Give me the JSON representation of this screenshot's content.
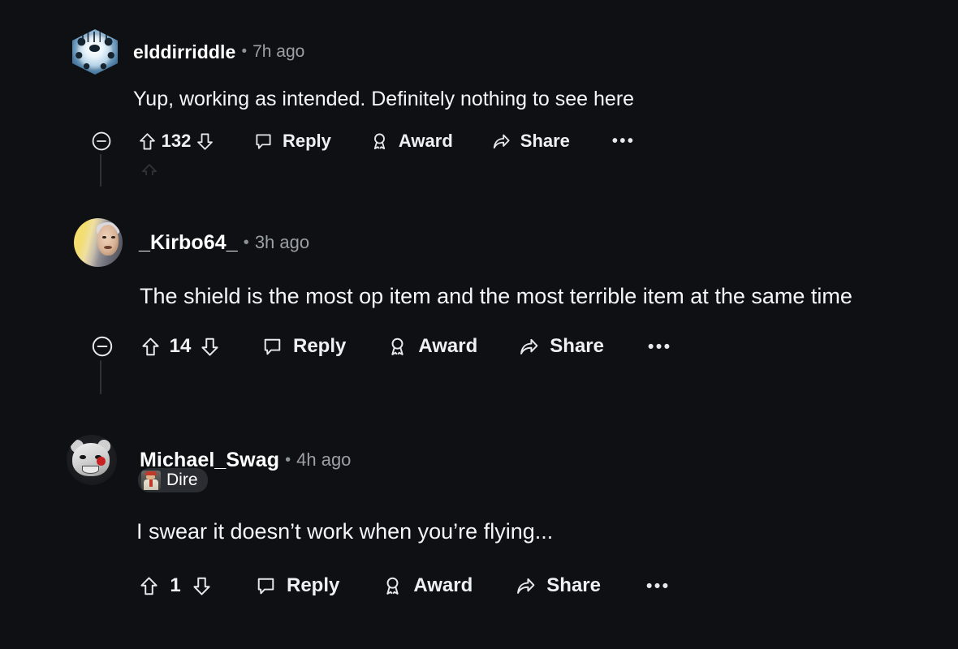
{
  "theme": {
    "background": "#0e1013",
    "text_primary": "#f4f6f7",
    "text_muted": "#9aa0a6",
    "thread_line": "#2f3336",
    "flair_background": "#2a2d31"
  },
  "separator": "•",
  "overflow_label": "•••",
  "action_labels": {
    "collapse": "Collapse",
    "upvote": "Upvote",
    "downvote": "Downvote",
    "reply": "Reply",
    "award": "Award",
    "share": "Share",
    "more": "More options"
  },
  "comments": [
    {
      "username": "elddirriddle",
      "timestamp": "7h ago",
      "body": "Yup, working as intended. Definitely nothing to see here",
      "score": "132",
      "avatar_kind": "hex-nft-icy",
      "has_collapse": true,
      "flair": null,
      "actions": [
        {
          "name": "reply",
          "label": "Reply",
          "icon": "comment-bubble-icon"
        },
        {
          "name": "award",
          "label": "Award",
          "icon": "award-ribbon-icon"
        },
        {
          "name": "share",
          "label": "Share",
          "icon": "share-arrow-icon"
        }
      ]
    },
    {
      "username": "_Kirbo64_",
      "timestamp": "3h ago",
      "body": "The shield is the most op item and the most terrible item at the same time",
      "score": "14",
      "avatar_kind": "photo-yellow-face",
      "has_collapse": true,
      "flair": null,
      "actions": [
        {
          "name": "reply",
          "label": "Reply",
          "icon": "comment-bubble-icon"
        },
        {
          "name": "award",
          "label": "Award",
          "icon": "award-ribbon-icon"
        },
        {
          "name": "share",
          "label": "Share",
          "icon": "share-arrow-icon"
        }
      ]
    },
    {
      "username": "Michael_Swag",
      "timestamp": "4h ago",
      "body": "I swear it doesn’t work when you’re flying...",
      "score": "1",
      "avatar_kind": "cartoon-greyscale",
      "has_collapse": false,
      "flair": {
        "label": "Dire",
        "icon": "flair-character-icon"
      },
      "actions": [
        {
          "name": "reply",
          "label": "Reply",
          "icon": "comment-bubble-icon"
        },
        {
          "name": "award",
          "label": "Award",
          "icon": "award-ribbon-icon"
        },
        {
          "name": "share",
          "label": "Share",
          "icon": "share-arrow-icon"
        }
      ]
    }
  ]
}
